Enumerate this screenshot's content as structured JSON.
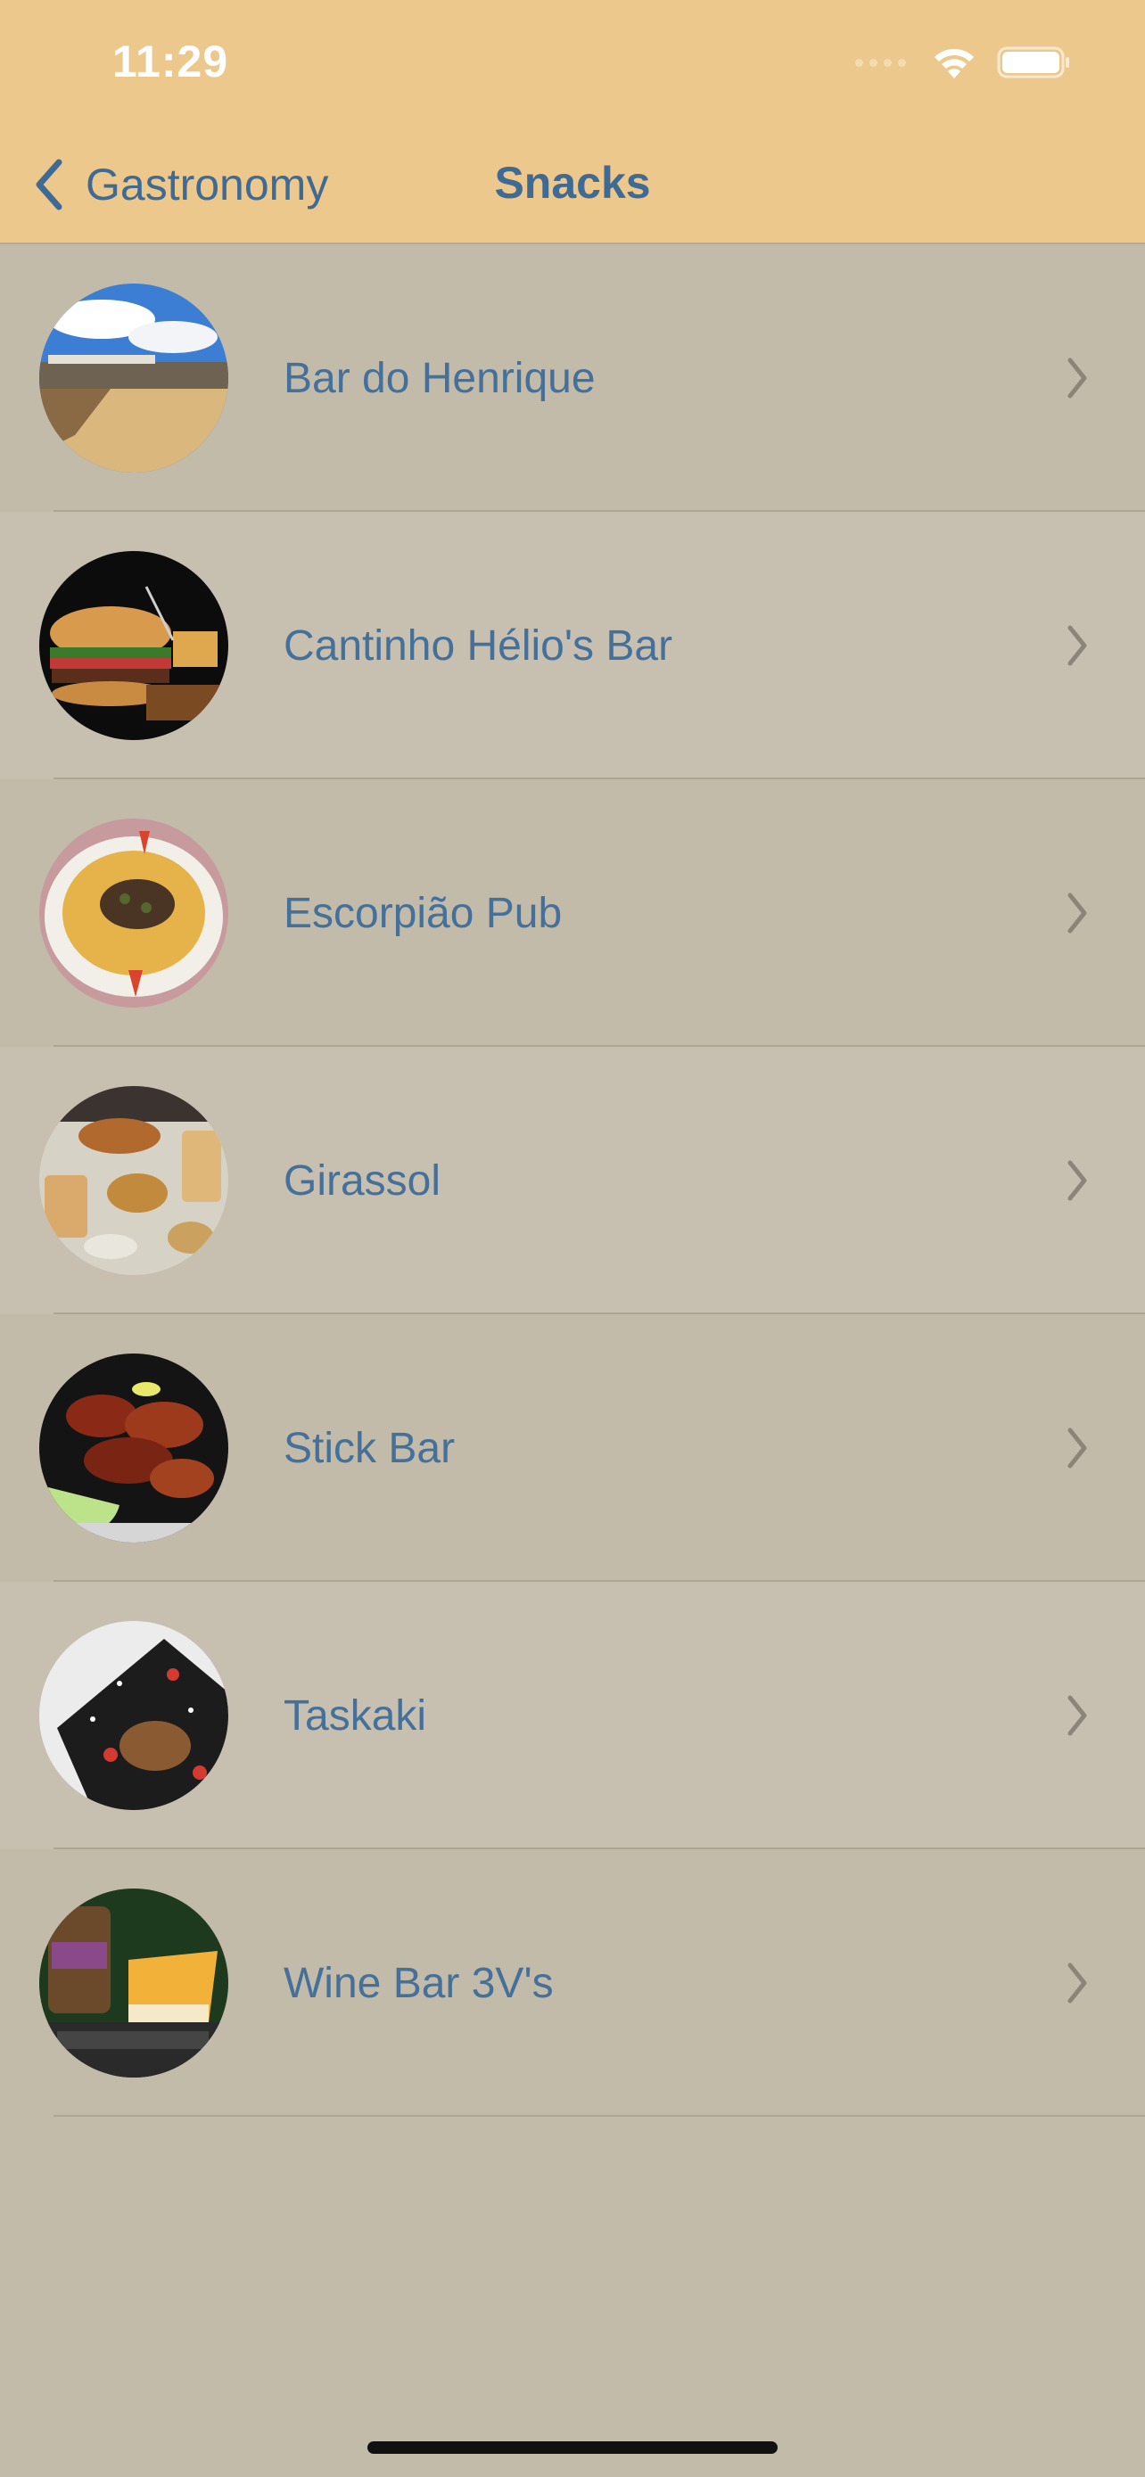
{
  "status_bar": {
    "time": "11:29",
    "icons": [
      "signal-icon",
      "wifi-icon",
      "battery-icon"
    ]
  },
  "nav": {
    "back_label": "Gastronomy",
    "back_icon": "chevron-left-icon",
    "title": "Snacks"
  },
  "colors": {
    "header": "#edc88c",
    "accent": "#3e6a93",
    "row_a": "#c2bba9",
    "row_b": "#c7c0b1"
  },
  "list": {
    "items": [
      {
        "label": "Bar do Henrique",
        "thumb_icon": "beach-bar-photo"
      },
      {
        "label": "Cantinho Hélio's Bar",
        "thumb_icon": "burger-photo"
      },
      {
        "label": "Escorpião Pub",
        "thumb_icon": "fries-steak-photo"
      },
      {
        "label": "Girassol",
        "thumb_icon": "drinks-snacks-photo"
      },
      {
        "label": "Stick Bar",
        "thumb_icon": "chicken-wings-photo"
      },
      {
        "label": "Taskaki",
        "thumb_icon": "dessert-plate-photo"
      },
      {
        "label": "Wine Bar 3V's",
        "thumb_icon": "cheesecake-jar-photo"
      }
    ]
  }
}
